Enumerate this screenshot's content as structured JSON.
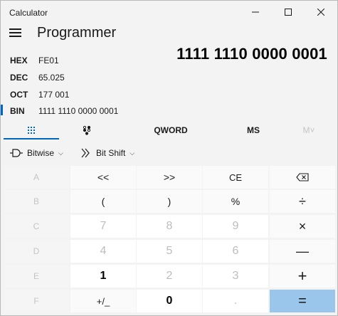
{
  "window": {
    "title": "Calculator",
    "minimize_glyph": "—",
    "maximize_glyph": "□",
    "close_glyph": "✕"
  },
  "header": {
    "menu_icon": "hamburger-menu-icon",
    "mode_title": "Programmer"
  },
  "display": {
    "value": "1111 1110 0000 0001"
  },
  "radix": [
    {
      "label": "HEX",
      "value": "FE01",
      "selected": false
    },
    {
      "label": "DEC",
      "value": "65.025",
      "selected": false
    },
    {
      "label": "OCT",
      "value": "177 001",
      "selected": false
    },
    {
      "label": "BIN",
      "value": "1111 1110 0000 0001",
      "selected": true
    }
  ],
  "tabs": {
    "keypad_icon": "full-keypad-icon",
    "bittoggle_icon": "bit-toggling-keypad-icon",
    "word_size": "QWORD",
    "memory_store": "MS",
    "memory_list": "M˅"
  },
  "toolbar": {
    "bitwise_label": "Bitwise",
    "bitwise_icon": "logic-gate-icon",
    "bitshift_label": "Bit Shift",
    "bitshift_icon": "bit-shift-icon"
  },
  "keys": {
    "A": "A",
    "lsh": "<<",
    "rsh": ">>",
    "ce": "CE",
    "backspace_icon": "backspace-icon",
    "B": "B",
    "lparen": "(",
    "rparen": ")",
    "mod": "%",
    "divide": "÷",
    "C": "C",
    "seven": "7",
    "eight": "8",
    "nine": "9",
    "multiply": "×",
    "D": "D",
    "four": "4",
    "five": "5",
    "six": "6",
    "minus": "—",
    "E": "E",
    "one": "1",
    "two": "2",
    "three": "3",
    "plus": "+",
    "F": "F",
    "negate": "+/_",
    "zero": "0",
    "decimal": ".",
    "equals": "="
  },
  "colors": {
    "accent": "#0067c0",
    "equals_bg": "#99c6ea"
  }
}
